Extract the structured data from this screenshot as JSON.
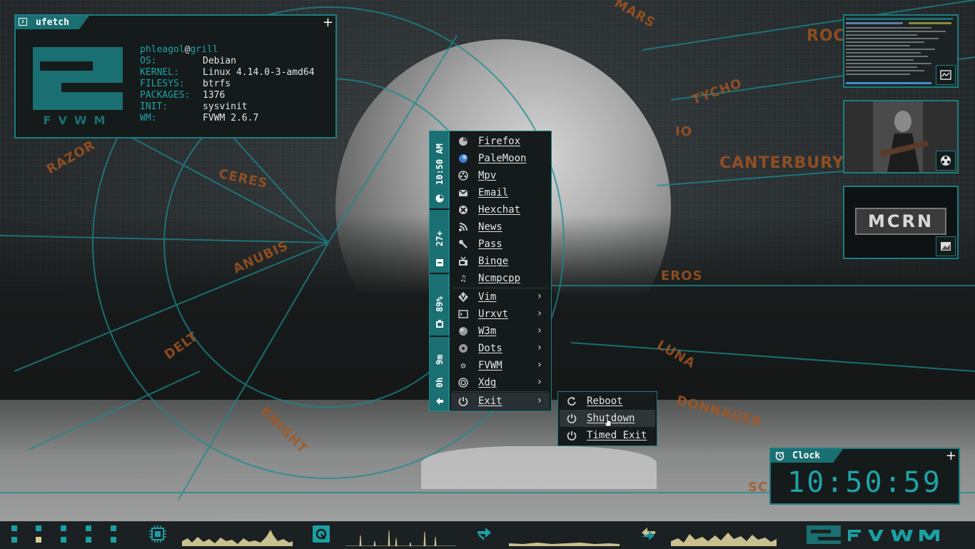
{
  "ufetch": {
    "title": "ufetch",
    "user": "phleagol",
    "at": "@",
    "host": "grill",
    "rows": [
      {
        "key": "OS:",
        "value": "Debian"
      },
      {
        "key": "KERNEL:",
        "value": "Linux 4.14.0-3-amd64"
      },
      {
        "key": "FILESYS:",
        "value": "btrfs"
      },
      {
        "key": "PACKAGES:",
        "value": "1376"
      },
      {
        "key": "INIT:",
        "value": "sysvinit"
      },
      {
        "key": "WM:",
        "value": "FVWM 2.6.7"
      }
    ],
    "logo_text": "FVWM"
  },
  "panel": {
    "time": "10:50 AM",
    "temp": "27+",
    "battery": "89%",
    "uptime_m": "9m",
    "uptime_h": "0h"
  },
  "menu": {
    "items": [
      {
        "label": "Firefox",
        "icon": "firefox-icon"
      },
      {
        "label": "PaleMoon",
        "icon": "palemoon-icon"
      },
      {
        "label": "Mpv",
        "icon": "film-reel-icon"
      },
      {
        "label": "Email",
        "icon": "envelope-icon"
      },
      {
        "label": "Hexchat",
        "icon": "chat-icon"
      },
      {
        "label": "News",
        "icon": "rss-icon"
      },
      {
        "label": "Pass",
        "icon": "key-icon"
      },
      {
        "label": "Binge",
        "icon": "tv-icon"
      },
      {
        "label": "Ncmpcpp",
        "icon": "music-note-icon"
      },
      {
        "label": "Vim",
        "icon": "vim-icon"
      },
      {
        "label": "Urxvt",
        "icon": "terminal-icon"
      },
      {
        "label": "W3m",
        "icon": "globe-icon"
      },
      {
        "label": "Dots",
        "icon": "dots-icon"
      },
      {
        "label": "FVWM",
        "icon": "gear-icon"
      },
      {
        "label": "Xdg",
        "icon": "spiral-icon"
      },
      {
        "label": "Exit",
        "icon": "power-icon"
      }
    ],
    "arrow": "›"
  },
  "submenu": {
    "items": [
      {
        "label": "Reboot",
        "icon": "reboot-icon"
      },
      {
        "label": "Shutdown",
        "icon": "power-icon"
      },
      {
        "label": "Timed Exit",
        "icon": "power-icon"
      }
    ]
  },
  "thumbs": {
    "mcrn": "MCRN"
  },
  "clock": {
    "title": "Clock",
    "time": "10:50:59"
  },
  "wallpaper": {
    "places": [
      "MARS",
      "ROC",
      "TYCHO",
      "IO",
      "CANTERBURY",
      "CERES",
      "ANUBIS",
      "EROS",
      "DELT",
      "LUNA",
      "KNIGHT",
      "RAZOR",
      "DONNAGER",
      "SC"
    ]
  },
  "colors": {
    "accent": "#1a6f72",
    "accent_bright": "#1fa3a6",
    "menu_bg": "#151a1b",
    "active_desk": "#d8cc96"
  },
  "bottombar": {
    "logo": "FVWM"
  }
}
